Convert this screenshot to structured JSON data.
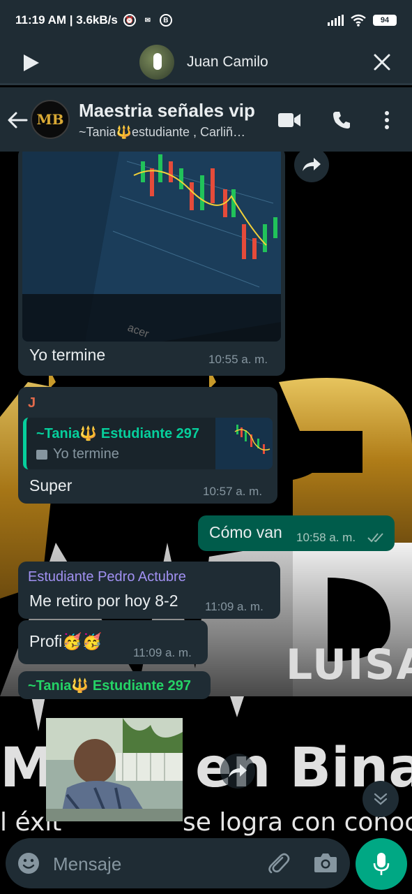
{
  "status_bar": {
    "time_speed": "11:19 AM | 3.6kB/s",
    "battery": "94",
    "icons": [
      "alarm-icon",
      "messenger-icon",
      "b-badge-icon",
      "signal-icon",
      "wifi-icon",
      "battery-icon"
    ]
  },
  "voice_call": {
    "name": "Juan Camilo",
    "icons": [
      "play-icon",
      "close-icon"
    ]
  },
  "header": {
    "avatar_text": "MB",
    "title": "Maestria señales vip",
    "subtitle": "~Tania🔱estudiante , Carliñ…",
    "icons": [
      "back-arrow-icon",
      "video-call-icon",
      "phone-icon",
      "more-vert-icon"
    ]
  },
  "background_watermark": {
    "brand_lines": [
      "LUISA",
      "Maestria en Binarias",
      "El éxito se logra con conocimiento"
    ],
    "visible_text": [
      "Ma",
      "en Binar",
      "l éxit",
      "se logra con conocimi"
    ]
  },
  "messages": [
    {
      "type": "image",
      "caption": "Yo termine",
      "time": "10:55 a. m.",
      "direction": "in"
    },
    {
      "type": "reply",
      "sender": "J",
      "sender_color": "#e26a4b",
      "quote_author": "~Tania🔱 Estudiante 297",
      "quote_text": "Yo termine",
      "quote_color": "#06cf9c",
      "text": "Super",
      "time": "10:57 a. m.",
      "direction": "in"
    },
    {
      "type": "text",
      "text": "Cómo van",
      "time": "10:58 a. m.",
      "direction": "out",
      "status": "read"
    },
    {
      "type": "text",
      "sender": "Estudiante Pedro Actubre",
      "sender_color": "#a191f2",
      "text": "Me retiro por hoy 8-2",
      "time": "11:09 a. m.",
      "direction": "in"
    },
    {
      "type": "text",
      "text": "Profi🥳🥳",
      "time": "11:09 a. m.",
      "direction": "in"
    },
    {
      "type": "gif",
      "sender": "~Tania🔱 Estudiante 297",
      "sender_color": "#25d366",
      "direction": "in"
    }
  ],
  "composer": {
    "placeholder": "Mensaje",
    "icons": [
      "emoji-icon",
      "attach-icon",
      "camera-icon",
      "mic-icon"
    ]
  },
  "colors": {
    "header_bg": "#1f2c34",
    "bubble_in": "#1f2c34",
    "bubble_out": "#005c4b",
    "accent": "#00a884"
  }
}
